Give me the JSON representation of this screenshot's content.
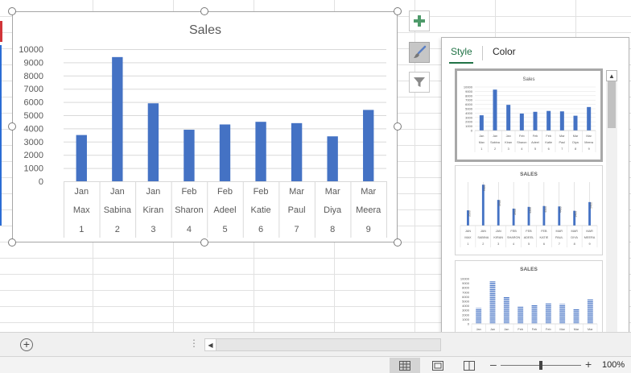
{
  "chart": {
    "title": "Sales"
  },
  "chart_data": {
    "type": "bar",
    "title": "Sales",
    "categories": [
      [
        "Jan",
        "Max",
        "1"
      ],
      [
        "Jan",
        "Sabina",
        "2"
      ],
      [
        "Jan",
        "Kiran",
        "3"
      ],
      [
        "Feb",
        "Sharon",
        "4"
      ],
      [
        "Feb",
        "Adeel",
        "5"
      ],
      [
        "Feb",
        "Katie",
        "6"
      ],
      [
        "Mar",
        "Paul",
        "7"
      ],
      [
        "Mar",
        "Diya",
        "8"
      ],
      [
        "Mar",
        "Meera",
        "9"
      ]
    ],
    "values": [
      3500,
      9400,
      5900,
      3900,
      4300,
      4500,
      4400,
      3400,
      5400
    ],
    "ylim": [
      0,
      10000
    ],
    "yticks": [
      0,
      1000,
      2000,
      3000,
      4000,
      5000,
      6000,
      7000,
      8000,
      9000,
      10000
    ],
    "grid": true,
    "legend": "none",
    "bar_color": "#4472c4"
  },
  "side_buttons": {
    "elements_icon": "plus-icon",
    "styles_icon": "paintbrush-icon",
    "filter_icon": "funnel-icon"
  },
  "panel": {
    "tabs": [
      {
        "label": "Style"
      },
      {
        "label": "Color"
      }
    ],
    "thumbnails": [
      {
        "title": "Sales"
      },
      {
        "title": "SALES"
      },
      {
        "title": "SALES"
      }
    ]
  },
  "statusbar": {
    "zoom_label": "100%"
  },
  "colors": {
    "accent": "#217346",
    "bar": "#4472c4"
  }
}
